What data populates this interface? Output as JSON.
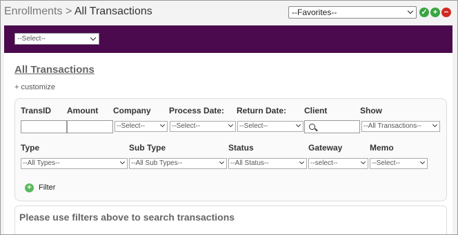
{
  "header": {
    "breadcrumb_parent": "Enrollments",
    "separator": ">",
    "breadcrumb_current": "All Transactions",
    "favorites": "--Favorites--",
    "icons": [
      "check-icon",
      "add-icon",
      "remove-icon"
    ]
  },
  "toolbar": {
    "select_placeholder": "--Select--"
  },
  "page": {
    "title": "All Transactions",
    "customize": "+ customize"
  },
  "filters": {
    "row1": {
      "transid_label": "TransID",
      "amount_label": "Amount",
      "company_label": "Company",
      "company_value": "--Select--",
      "process_date_label": "Process Date:",
      "process_date_value": "--Select--",
      "return_date_label": "Return Date:",
      "return_date_value": "--Select--",
      "client_label": "Client",
      "show_label": "Show",
      "show_value": "--All Transactions--"
    },
    "row2": {
      "type_label": "Type",
      "type_value": "--All Types--",
      "subtype_label": "Sub Type",
      "subtype_value": "--All Sub Types--",
      "status_label": "Status",
      "status_value": "--All Status--",
      "gateway_label": "Gateway",
      "gateway_value": "--select--",
      "memo_label": "Memo",
      "memo_value": "--Select--"
    },
    "filter_button": "Filter"
  },
  "results": {
    "message": "Please use filters above to search transactions"
  },
  "colors": {
    "header_bar": "#4a0a4d",
    "confirm": "#3aa540",
    "remove": "#cf2b23"
  }
}
